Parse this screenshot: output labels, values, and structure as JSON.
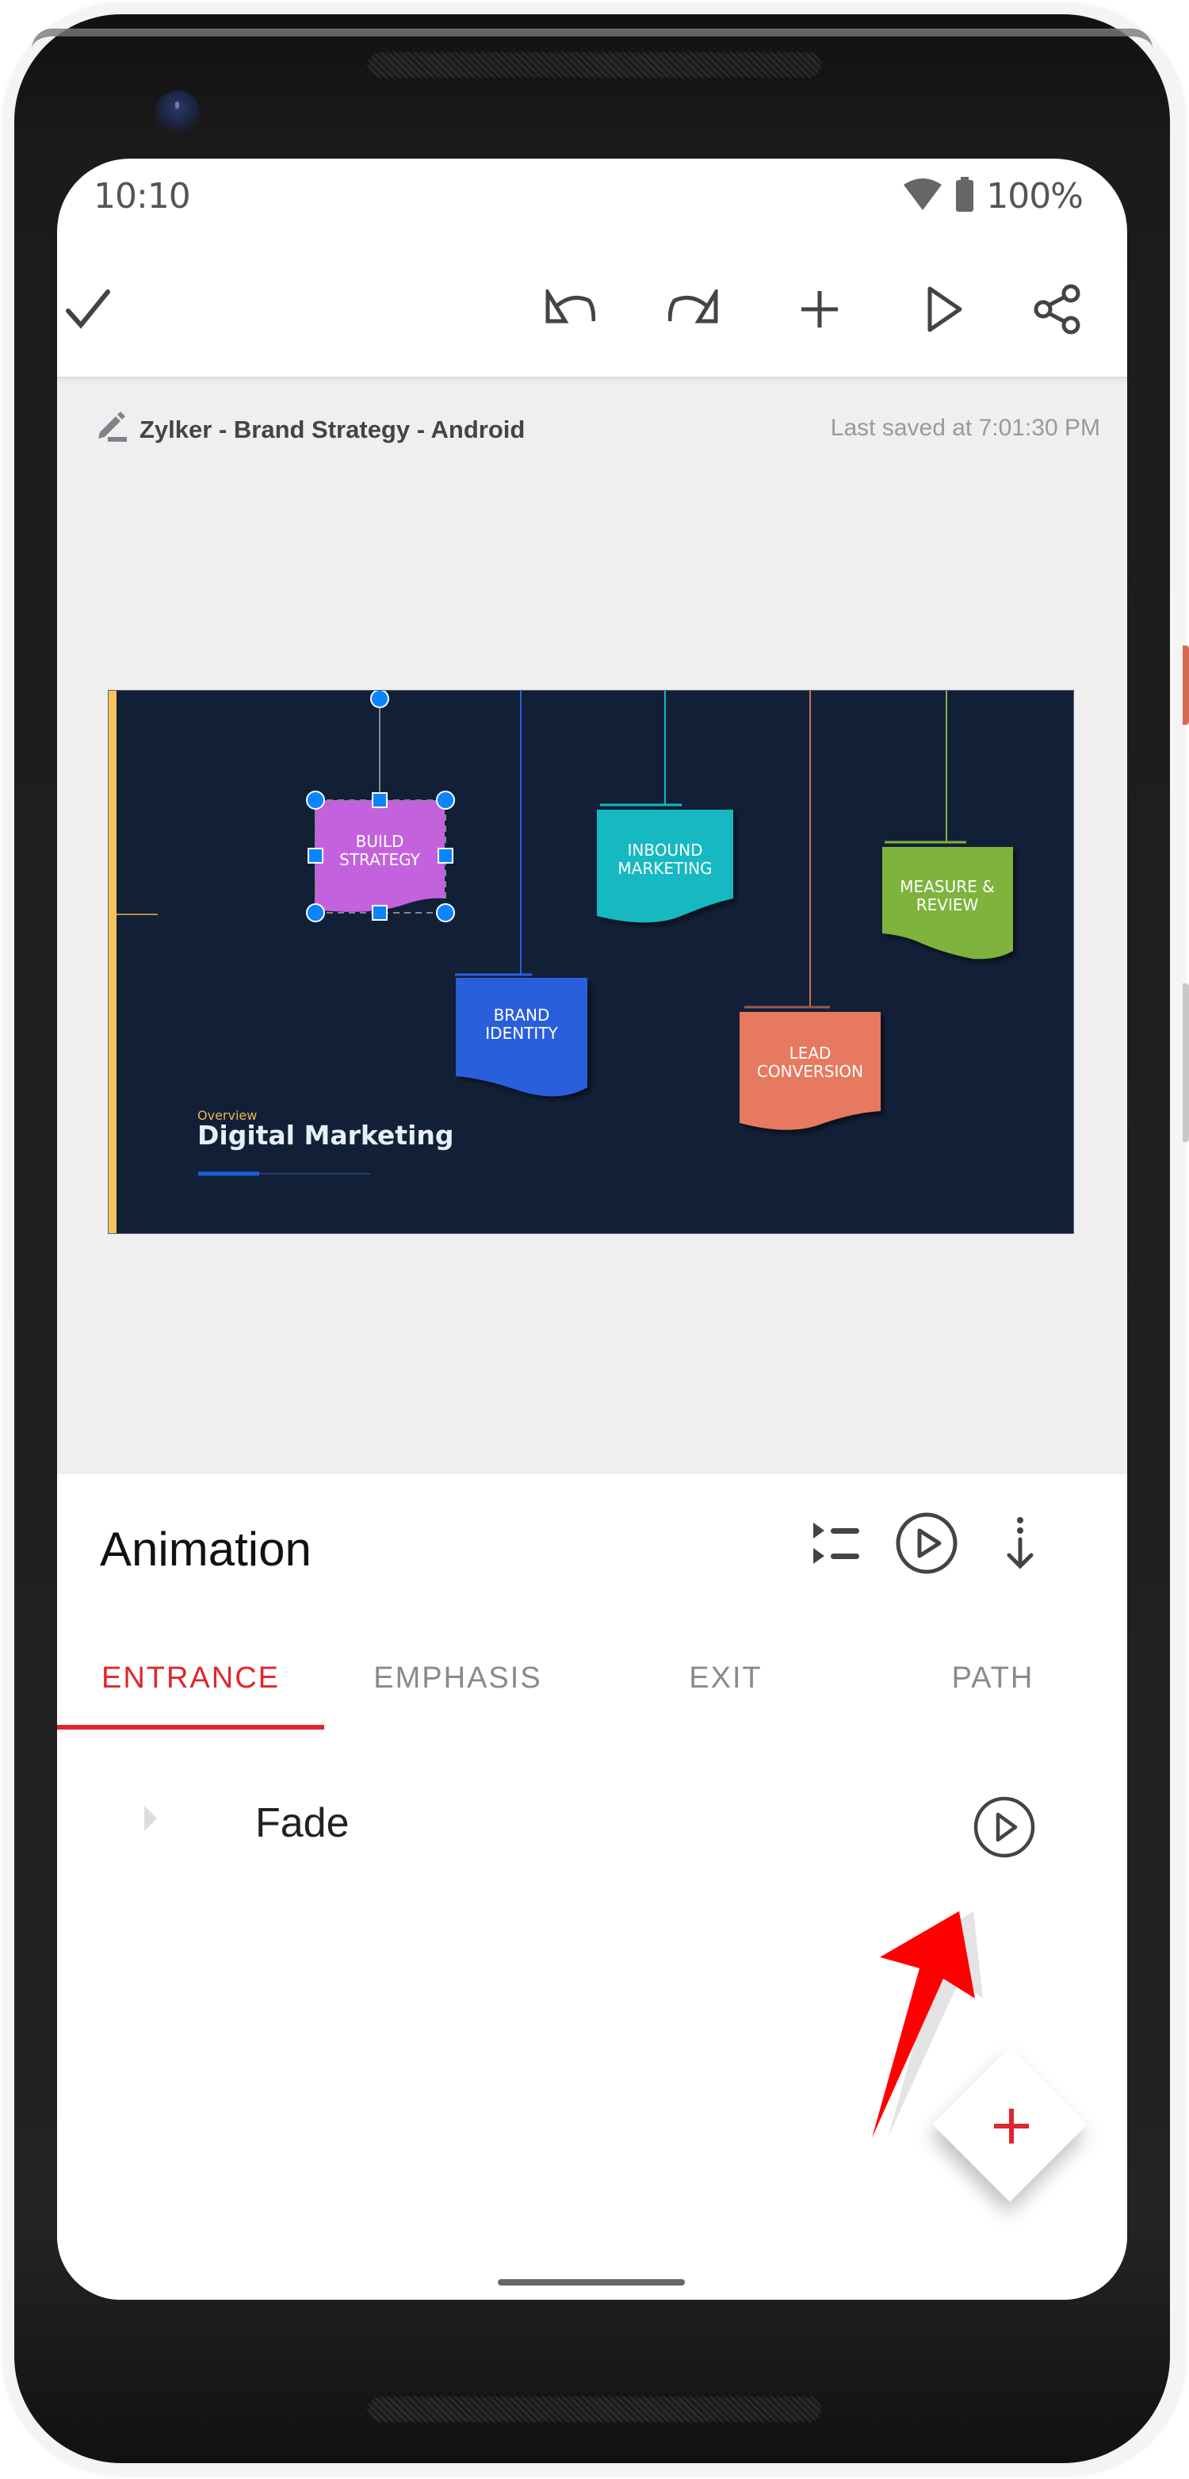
{
  "status_bar": {
    "time": "10:10",
    "battery_percent": "100%",
    "icons": [
      "wifi-icon",
      "battery-icon"
    ]
  },
  "toolbar": {
    "done_icon": "check-icon",
    "actions": [
      "undo-icon",
      "redo-icon",
      "add-icon",
      "play-icon",
      "share-icon"
    ]
  },
  "document": {
    "title": "Zylker - Brand Strategy - Android",
    "last_saved": "Last saved at 7:01:30 PM",
    "edit_icon": "pencil-icon"
  },
  "slide": {
    "subtitle": "Overview",
    "title": "Digital Marketing",
    "shapes": [
      {
        "line1": "BUILD",
        "line2": "STRATEGY",
        "color": "#c462de",
        "selected": true
      },
      {
        "line1": "BRAND",
        "line2": "IDENTITY",
        "color": "#2c5fdc"
      },
      {
        "line1": "INBOUND",
        "line2": "MARKETING",
        "color": "#14b9c1"
      },
      {
        "line1": "LEAD",
        "line2": "CONVERSION",
        "color": "#e77960"
      },
      {
        "line1": "MEASURE &",
        "line2": "REVIEW",
        "color": "#7eb33d"
      }
    ],
    "colors": {
      "background": "#122037",
      "accent_bar": "#f7c15c",
      "selection": "#0a84ff"
    }
  },
  "animation_panel": {
    "title": "Animation",
    "header_icons": [
      "reorder-list-icon",
      "play-circle-icon",
      "apply-down-icon"
    ],
    "tabs": [
      {
        "label": "ENTRANCE",
        "active": true
      },
      {
        "label": "EMPHASIS",
        "active": false
      },
      {
        "label": "EXIT",
        "active": false
      },
      {
        "label": "PATH",
        "active": false
      }
    ],
    "animations": [
      {
        "name": "Fade",
        "expand_icon": "chevron-right-icon",
        "play_icon": "play-circle-icon"
      }
    ],
    "fab_icon": "plus-icon",
    "accent_color": "#e0262c"
  },
  "annotation": {
    "type": "red-arrow",
    "color": "#ff0000"
  }
}
